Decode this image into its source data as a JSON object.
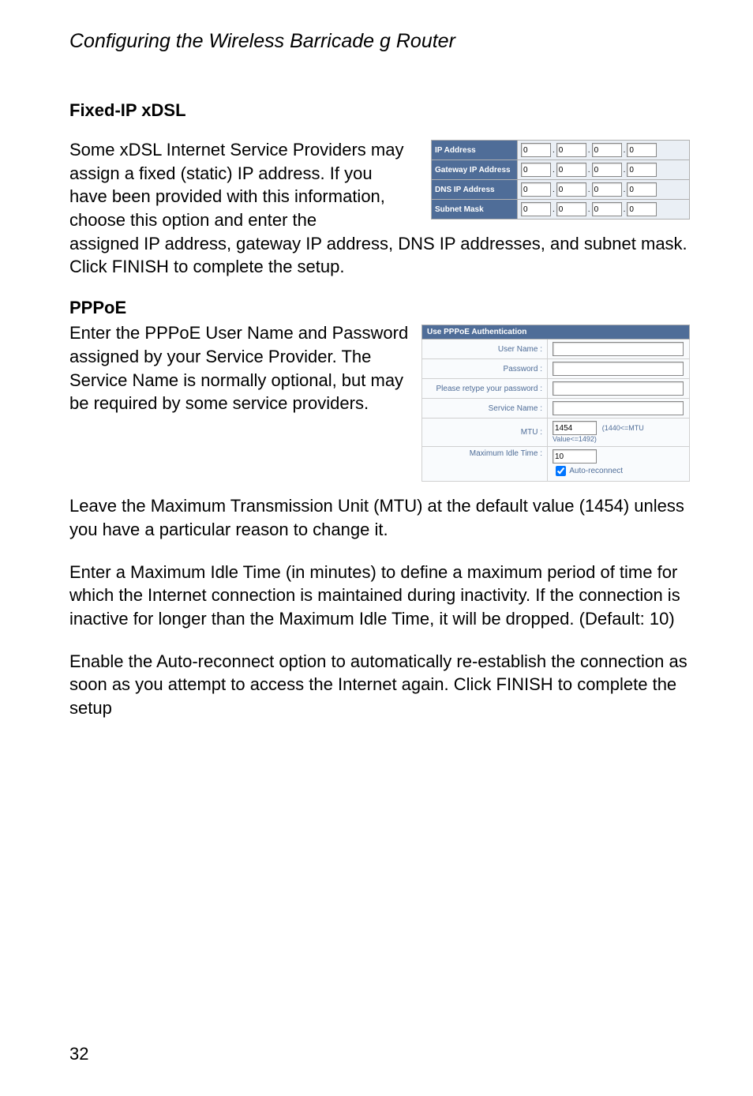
{
  "header": {
    "title": "Configuring the Wireless Barricade g Router"
  },
  "fixedip": {
    "title": "Fixed-IP xDSL",
    "paraLeft": "Some xDSL Internet Service Providers may assign a fixed (static) IP address. If you have been provided with this information, choose this option and enter the",
    "paraAfter": "assigned IP address, gateway IP address, DNS IP addresses, and subnet mask. Click FINISH to complete the setup.",
    "rows": {
      "ip": "IP Address",
      "gw": "Gateway IP Address",
      "dns": "DNS IP Address",
      "mask": "Subnet Mask"
    },
    "octet": "0"
  },
  "pppoe": {
    "title": "PPPoE",
    "paraLeft": "Enter the PPPoE User Name and Password assigned by your Service Provider. The Service Name is normally optional, but may be required by some service providers.",
    "header": "Use PPPoE Authentication",
    "labels": {
      "user": "User Name :",
      "pass": "Password :",
      "retype": "Please retype your password :",
      "service": "Service Name :",
      "mtu": "MTU :",
      "idle": "Maximum Idle Time :"
    },
    "mtuValue": "1454",
    "mtuHint": "(1440<=MTU Value<=1492)",
    "idleValue": "10",
    "autoLabel": "Auto-reconnect"
  },
  "paras": {
    "mtu": "Leave the Maximum Transmission Unit (MTU) at the default value (1454) unless you have a particular reason to change it.",
    "idle": "Enter a Maximum Idle Time (in minutes) to define a maximum period of time for which the Internet connection is maintained during inactivity. If the connection is inactive for longer than the Maximum Idle Time, it will be dropped. (Default: 10)",
    "auto": "Enable the Auto-reconnect option to automatically re-establish the connection as soon as you attempt to access the Internet again. Click FINISH to complete the setup"
  },
  "pageNumber": "32"
}
